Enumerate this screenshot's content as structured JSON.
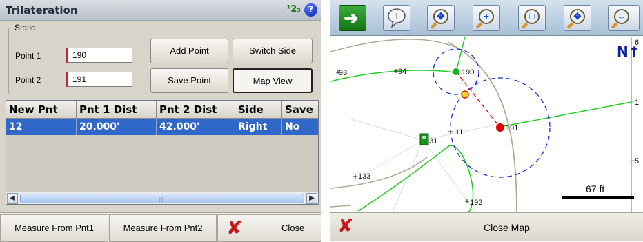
{
  "left": {
    "title": "Trilateration",
    "number_icon": "¹2₃",
    "help_icon_glyph": "?",
    "static_legend": "Static",
    "point1_label": "Point 1",
    "point1_value": "190",
    "point2_label": "Point 2",
    "point2_value": "191",
    "buttons": {
      "add_point": "Add Point",
      "switch_side": "Switch Side",
      "save_point": "Save Point",
      "map_view": "Map View"
    },
    "table": {
      "columns": [
        "New Pnt",
        "Pnt 1 Dist",
        "Pnt 2 Dist",
        "Side",
        "Save"
      ],
      "rows": [
        [
          "12",
          "20.000'",
          "42.000'",
          "Right",
          "No"
        ]
      ]
    },
    "bottom": {
      "measure_from_pnt1": "Measure From Pnt1",
      "measure_from_pnt2": "Measure From Pnt2",
      "close": "Close"
    }
  },
  "map": {
    "toolbar_icons": [
      "exit-arrow-icon",
      "info-balloon-icon",
      "zoom-extents-icon",
      "zoom-in-icon",
      "zoom-window-icon",
      "pan-icon",
      "zoom-previous-icon"
    ],
    "north_label": "N",
    "labels": {
      "p93": "93",
      "p94": "94",
      "p190": "190",
      "p191": "191",
      "p11": "11",
      "p31": "31",
      "p133": "133",
      "p192": "192",
      "edge_6": "6",
      "edge_1": "1",
      "edge_5": "5"
    },
    "scale_label": "67 ft",
    "close_map": "Close Map"
  },
  "colors": {
    "selection_blue": "#2f68c8",
    "line_green": "#22cc22",
    "circle_blue": "#1a2ed8",
    "point_red": "#e00000",
    "point_green": "#16b416",
    "close_red": "#c41818"
  }
}
